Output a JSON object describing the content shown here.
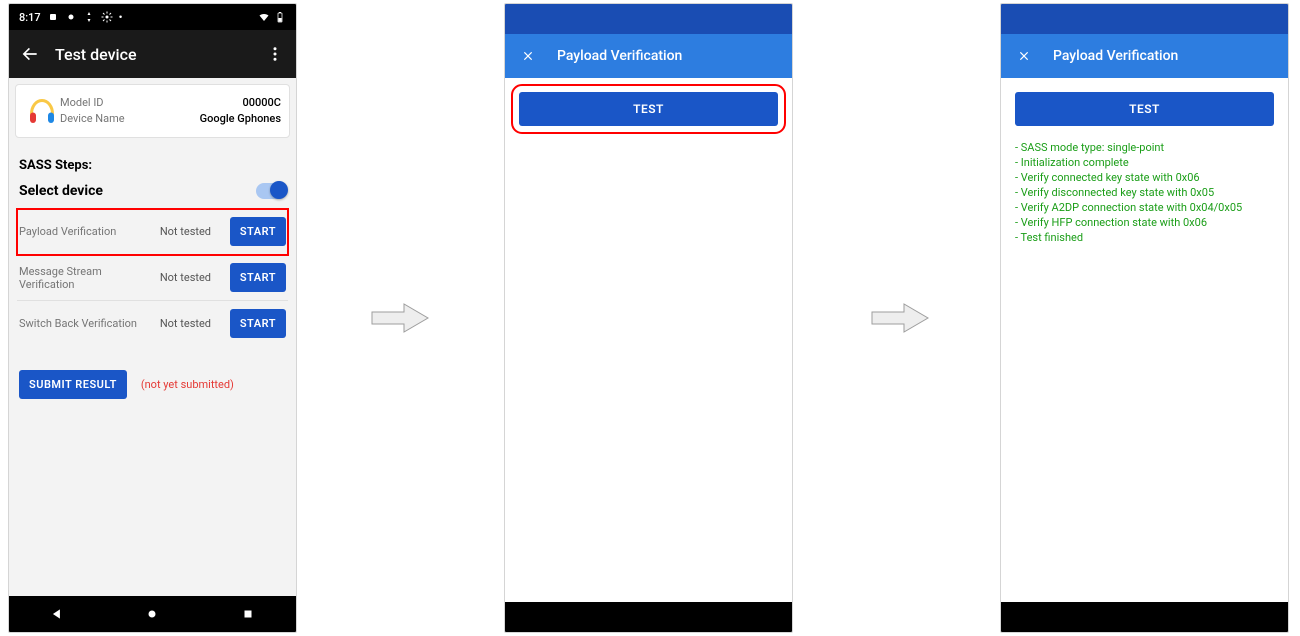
{
  "phone1": {
    "statusbar": {
      "time": "8:17"
    },
    "appbar": {
      "title": "Test device"
    },
    "card": {
      "model_id_label": "Model ID",
      "model_id": "00000C",
      "device_name_label": "Device Name",
      "device_name": "Google Gphones"
    },
    "section_label": "SASS Steps:",
    "select_label": "Select device",
    "tests": [
      {
        "name": "Payload Verification",
        "status": "Not tested",
        "btn": "START",
        "highlight": true
      },
      {
        "name": "Message Stream Verification",
        "status": "Not tested",
        "btn": "START",
        "highlight": false
      },
      {
        "name": "Switch Back Verification",
        "status": "Not tested",
        "btn": "START",
        "highlight": false
      }
    ],
    "submit": {
      "btn": "SUBMIT RESULT",
      "status": "(not yet submitted)"
    }
  },
  "phone2": {
    "title": "Payload Verification",
    "test_btn": "TEST"
  },
  "phone3": {
    "title": "Payload Verification",
    "test_btn": "TEST",
    "results": [
      "- SASS mode type: single-point",
      "- Initialization complete",
      "- Verify connected key state with 0x06",
      "- Verify disconnected key state with 0x05",
      "- Verify A2DP connection state with 0x04/0x05",
      "- Verify HFP connection state with 0x06",
      "- Test finished"
    ]
  }
}
